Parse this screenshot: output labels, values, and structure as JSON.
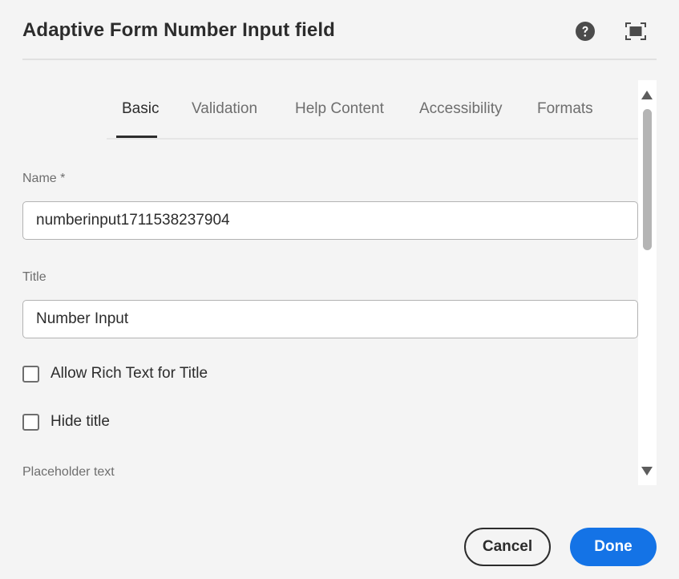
{
  "dialog": {
    "title": "Adaptive Form Number Input field",
    "help_icon": "help-circle-icon",
    "fullscreen_icon": "fullscreen-icon"
  },
  "tabs": [
    {
      "label": "Basic",
      "active": true
    },
    {
      "label": "Validation",
      "active": false
    },
    {
      "label": "Help Content",
      "active": false
    },
    {
      "label": "Accessibility",
      "active": false
    },
    {
      "label": "Formats",
      "active": false
    }
  ],
  "form": {
    "name": {
      "label": "Name *",
      "value": "numberinput1711538237904"
    },
    "title": {
      "label": "Title",
      "value": "Number Input"
    },
    "allow_rich_text": {
      "label": "Allow Rich Text for Title",
      "checked": false
    },
    "hide_title": {
      "label": "Hide title",
      "checked": false
    },
    "placeholder": {
      "label": "Placeholder text"
    }
  },
  "footer": {
    "cancel_label": "Cancel",
    "done_label": "Done"
  },
  "colors": {
    "accent": "#1473e6",
    "background": "#f4f4f4"
  }
}
